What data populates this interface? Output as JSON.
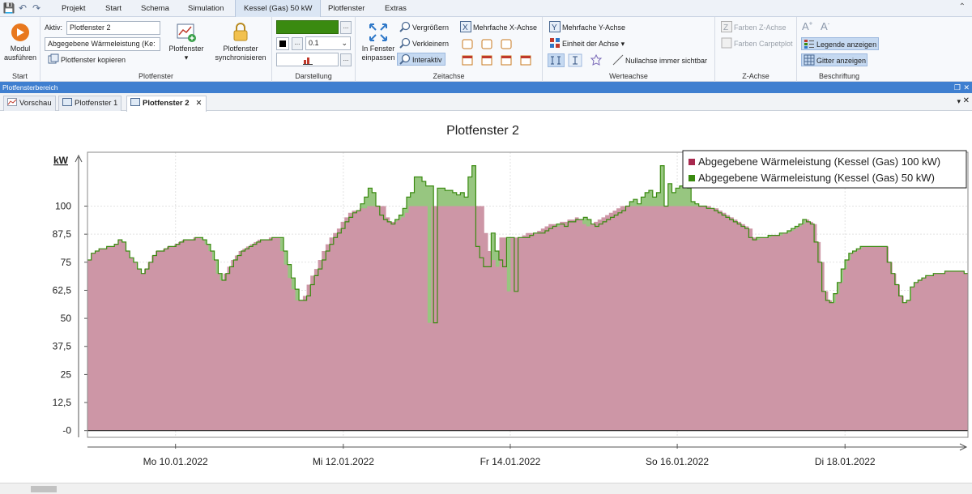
{
  "quick_access": {
    "save_icon": "save-icon",
    "undo_icon": "undo-icon",
    "redo_icon": "redo-icon"
  },
  "ribbon_tabs": [
    {
      "label": "Projekt",
      "selected": false
    },
    {
      "label": "Start",
      "selected": false
    },
    {
      "label": "Schema",
      "selected": false
    },
    {
      "label": "Simulation",
      "selected": false
    },
    {
      "label": "Kessel (Gas) 50 kW",
      "selected": true
    },
    {
      "label": "Plotfenster",
      "selected": false
    },
    {
      "label": "Extras",
      "selected": false
    }
  ],
  "ribbon": {
    "start_group": {
      "label": "Start",
      "run_button": "Modul ausführen"
    },
    "plotfenster_group": {
      "label": "Plotfenster",
      "active_label": "Aktiv:",
      "active_value": "Plotfenster 2",
      "series_select": "Abgegebene Wärmeleistung (Ke:",
      "copy_button": "Plotfenster kopieren",
      "plotfenster_button": "Plotfenster",
      "sync_button": "Plotfenster synchronisieren"
    },
    "darstellung_group": {
      "label": "Darstellung",
      "line_width": "0.1",
      "dots": "...",
      "color": "#3a8a10"
    },
    "zeitachse_group": {
      "label": "Zeitachse",
      "fit_button": "In Fenster einpassen",
      "zoom_in": "Vergrößern",
      "zoom_out": "Verkleinern",
      "interactive": "Interaktiv",
      "multi_x": "Mehrfache X-Achse"
    },
    "werteachse_group": {
      "label": "Werteachse",
      "multi_y": "Mehrfache Y-Achse",
      "unit": "Einheit der Achse",
      "zero_axis": "Nullachse immer sichtbar"
    },
    "zachse_group": {
      "label": "Z-Achse",
      "colors_z": "Farben Z-Achse",
      "colors_carpet": "Farben Carpetplot"
    },
    "beschriftung_group": {
      "label": "Beschriftung",
      "legend": "Legende anzeigen",
      "grid": "Gitter anzeigen"
    }
  },
  "panel": {
    "title": "Plotfensterbereich"
  },
  "doc_tabs": [
    {
      "label": "Vorschau",
      "selected": false
    },
    {
      "label": "Plotfenster 1",
      "selected": false
    },
    {
      "label": "Plotfenster 2",
      "selected": true
    }
  ],
  "chart_data": {
    "type": "area",
    "title": "Plotfenster 2",
    "ylabel": "kW",
    "ylim": [
      -3,
      124
    ],
    "yticks": [
      "-0",
      "12,5",
      "25",
      "37,5",
      "50",
      "62,5",
      "75",
      "87,5",
      "100"
    ],
    "ytick_values": [
      0,
      12.5,
      25,
      37.5,
      50,
      62.5,
      75,
      87.5,
      100
    ],
    "x_range_days": [
      0,
      10.6
    ],
    "xticks": [
      {
        "label": "Mo 10.01.2022",
        "day": 1.06
      },
      {
        "label": "Mi 12.01.2022",
        "day": 3.08
      },
      {
        "label": "Fr 14.01.2022",
        "day": 5.09
      },
      {
        "label": "So 16.01.2022",
        "day": 7.1
      },
      {
        "label": "Di 18.01.2022",
        "day": 9.12
      }
    ],
    "grid": true,
    "legend_position": "top-right",
    "series": [
      {
        "name": "Abgegebene Wärmeleistung (Kessel (Gas) 100 kW)",
        "color": "#a8294e",
        "fill": "#cd96a6",
        "values": [
          76,
          79,
          80,
          81,
          81,
          82,
          82,
          83,
          85,
          84,
          80,
          77,
          75,
          72,
          70,
          72,
          75,
          78,
          80,
          80,
          81,
          82,
          82,
          83,
          84,
          85,
          85,
          85,
          86,
          86,
          85,
          83,
          80,
          76,
          70,
          67,
          70,
          73,
          76,
          78,
          80,
          81,
          82,
          83,
          84,
          85,
          85,
          85,
          86,
          86,
          86,
          80,
          74,
          68,
          63,
          58,
          58,
          60,
          65,
          69,
          72,
          76,
          80,
          83,
          86,
          88,
          90,
          93,
          95,
          97,
          98,
          98,
          99,
          99,
          100,
          100,
          100,
          100,
          100,
          95,
          93,
          93,
          94,
          95,
          97,
          100,
          100,
          100,
          100,
          100,
          48,
          100,
          100,
          100,
          100,
          100,
          100,
          100,
          100,
          100,
          100,
          100,
          100,
          100,
          100,
          88,
          80,
          76,
          73,
          86,
          86,
          62,
          86,
          86,
          86,
          87,
          88,
          88,
          88,
          89,
          90,
          91,
          92,
          92,
          91,
          93,
          93,
          94,
          94,
          95,
          94,
          92,
          91,
          92,
          93,
          94,
          95,
          96,
          97,
          98,
          99,
          100,
          100,
          100,
          100,
          100,
          100,
          100,
          100,
          100,
          100,
          100,
          100,
          100,
          100,
          100,
          100,
          100,
          100,
          100,
          100,
          100,
          100,
          100,
          100,
          99,
          99,
          98,
          97,
          96,
          95,
          94,
          93,
          92,
          91,
          90,
          86,
          85,
          86,
          86,
          86,
          87,
          87,
          87,
          88,
          88,
          89,
          90,
          91,
          92,
          94,
          93,
          92,
          84,
          75,
          62,
          58,
          57,
          61,
          66,
          72,
          76,
          79,
          80,
          81,
          82,
          82,
          82,
          82,
          82,
          82,
          82,
          75,
          70,
          65,
          60,
          57,
          58,
          64,
          66,
          67,
          68,
          69,
          69,
          70,
          70,
          70,
          71,
          71,
          71,
          71,
          71,
          70
        ]
      },
      {
        "name": "Abgegebene Wärmeleistung (Kessel (Gas) 50 kW)",
        "color": "#3a8a10",
        "fill": "#97c680",
        "values": [
          76,
          79,
          80,
          81,
          81,
          82,
          82,
          83,
          85,
          84,
          80,
          77,
          75,
          72,
          70,
          72,
          75,
          78,
          80,
          80,
          81,
          82,
          82,
          83,
          84,
          85,
          85,
          85,
          86,
          86,
          85,
          83,
          80,
          76,
          70,
          67,
          70,
          73,
          76,
          78,
          80,
          81,
          82,
          83,
          84,
          85,
          85,
          85,
          86,
          86,
          86,
          80,
          74,
          68,
          63,
          58,
          58,
          60,
          65,
          69,
          72,
          76,
          80,
          83,
          86,
          88,
          90,
          93,
          95,
          97,
          98,
          101,
          104,
          108,
          106,
          100,
          96,
          94,
          93,
          92,
          94,
          96,
          99,
          104,
          106,
          113,
          113,
          111,
          109,
          109,
          48,
          108,
          108,
          107,
          107,
          106,
          105,
          106,
          104,
          113,
          118,
          82,
          77,
          73,
          73,
          88,
          80,
          76,
          73,
          86,
          86,
          62,
          86,
          86,
          86,
          87,
          88,
          88,
          88,
          89,
          90,
          91,
          92,
          92,
          91,
          93,
          93,
          94,
          94,
          95,
          94,
          92,
          91,
          92,
          93,
          94,
          95,
          96,
          97,
          98,
          100,
          102,
          103,
          101,
          104,
          106,
          107,
          104,
          106,
          118,
          100,
          110,
          106,
          108,
          109,
          113,
          108,
          102,
          101,
          100,
          100,
          99,
          99,
          98,
          97,
          96,
          95,
          94,
          93,
          92,
          91,
          90,
          86,
          85,
          86,
          86,
          86,
          87,
          87,
          87,
          88,
          88,
          89,
          90,
          91,
          92,
          94,
          93,
          92,
          84,
          75,
          62,
          58,
          57,
          61,
          66,
          72,
          76,
          79,
          80,
          81,
          82,
          82,
          82,
          82,
          82,
          82,
          82,
          75,
          70,
          65,
          60,
          57,
          58,
          64,
          66,
          67,
          68,
          69,
          69,
          70,
          70,
          70,
          71,
          71,
          71,
          71,
          71,
          70
        ]
      }
    ]
  }
}
